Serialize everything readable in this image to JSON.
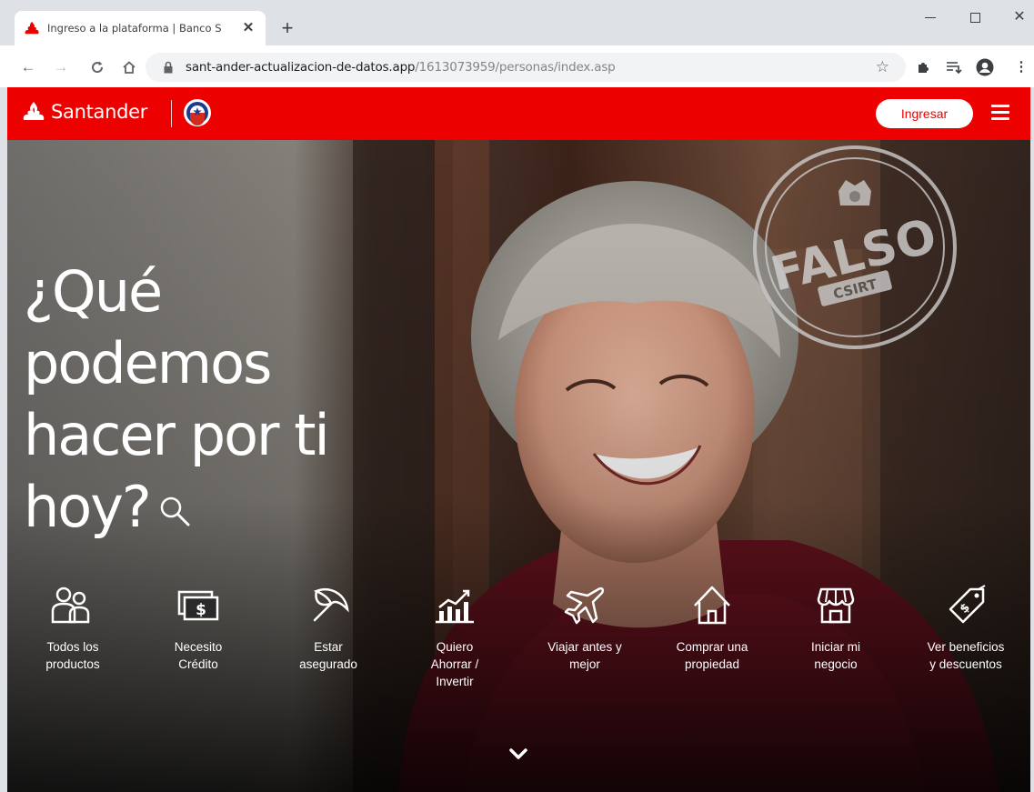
{
  "browser": {
    "tab_title": "Ingreso a la plataforma | Banco S",
    "url_host": "sant-ander-actualizacion-de-datos.app",
    "url_path": "/1613073959/personas/index.asp"
  },
  "header": {
    "brand": "Santander",
    "login_label": "Ingresar"
  },
  "hero": {
    "title_lines": {
      "l1": "¿Qué",
      "l2": "podemos",
      "l3": "hacer por ti",
      "l4": "hoy?"
    },
    "stamp_word": "FALSO",
    "stamp_sub": "CSIRT"
  },
  "products": [
    {
      "l1": "Todos los",
      "l2": "productos",
      "l3": "",
      "icon": "users-icon"
    },
    {
      "l1": "Necesito",
      "l2": "Crédito",
      "l3": "",
      "icon": "money-icon"
    },
    {
      "l1": "Estar",
      "l2": "asegurado",
      "l3": "",
      "icon": "umbrella-icon"
    },
    {
      "l1": "Quiero",
      "l2": "Ahorrar /",
      "l3": "Invertir",
      "icon": "growth-chart-icon"
    },
    {
      "l1": "Viajar antes y",
      "l2": "mejor",
      "l3": "",
      "icon": "airplane-icon"
    },
    {
      "l1": "Comprar una",
      "l2": "propiedad",
      "l3": "",
      "icon": "house-icon"
    },
    {
      "l1": "Iniciar mi",
      "l2": "negocio",
      "l3": "",
      "icon": "store-icon"
    },
    {
      "l1": "Ver beneficios",
      "l2": "y descuentos",
      "l3": "",
      "icon": "discount-tag-icon"
    }
  ],
  "colors": {
    "brand_red": "#ec0000"
  }
}
